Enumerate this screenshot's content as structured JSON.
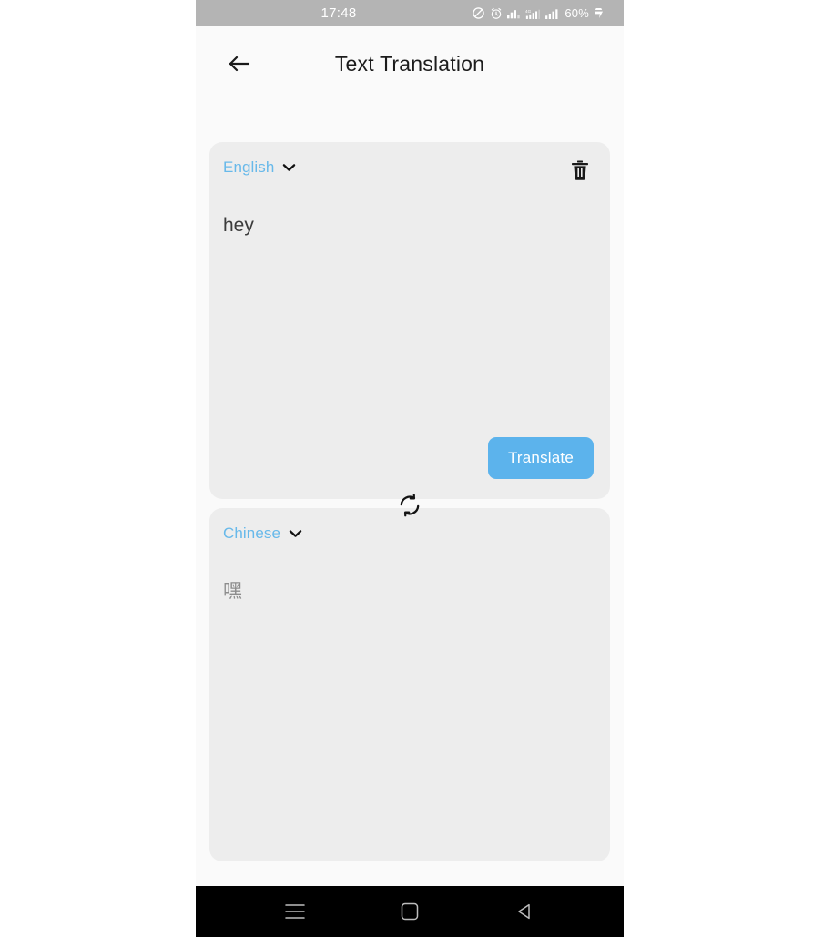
{
  "status_bar": {
    "time": "17:48",
    "battery_text": "60%",
    "icons": [
      "do-not-disturb-icon",
      "alarm-clock-icon",
      "signal-bars-icon",
      "network-4g-icon",
      "signal-strength-icon",
      "battery-charging-icon"
    ]
  },
  "app_bar": {
    "back_label": "back-arrow-icon",
    "title": "Text Translation"
  },
  "source_panel": {
    "language": "English",
    "text": "hey",
    "delete_label": "trash-icon",
    "translate_label": "Translate"
  },
  "target_panel": {
    "language": "Chinese",
    "text": "嘿"
  },
  "swap": {
    "label": "swap-languages-icon"
  },
  "nav_bar": {
    "recents_label": "recents-icon",
    "home_label": "home-icon",
    "back_label": "back-icon"
  },
  "colors": {
    "accent_blue": "#68b9ea",
    "translate_button": "#5cb3ec",
    "card_background": "#ededed",
    "page_background": "#fafafa",
    "status_bar": "#b4b4b4",
    "nav_bar": "#000000"
  }
}
